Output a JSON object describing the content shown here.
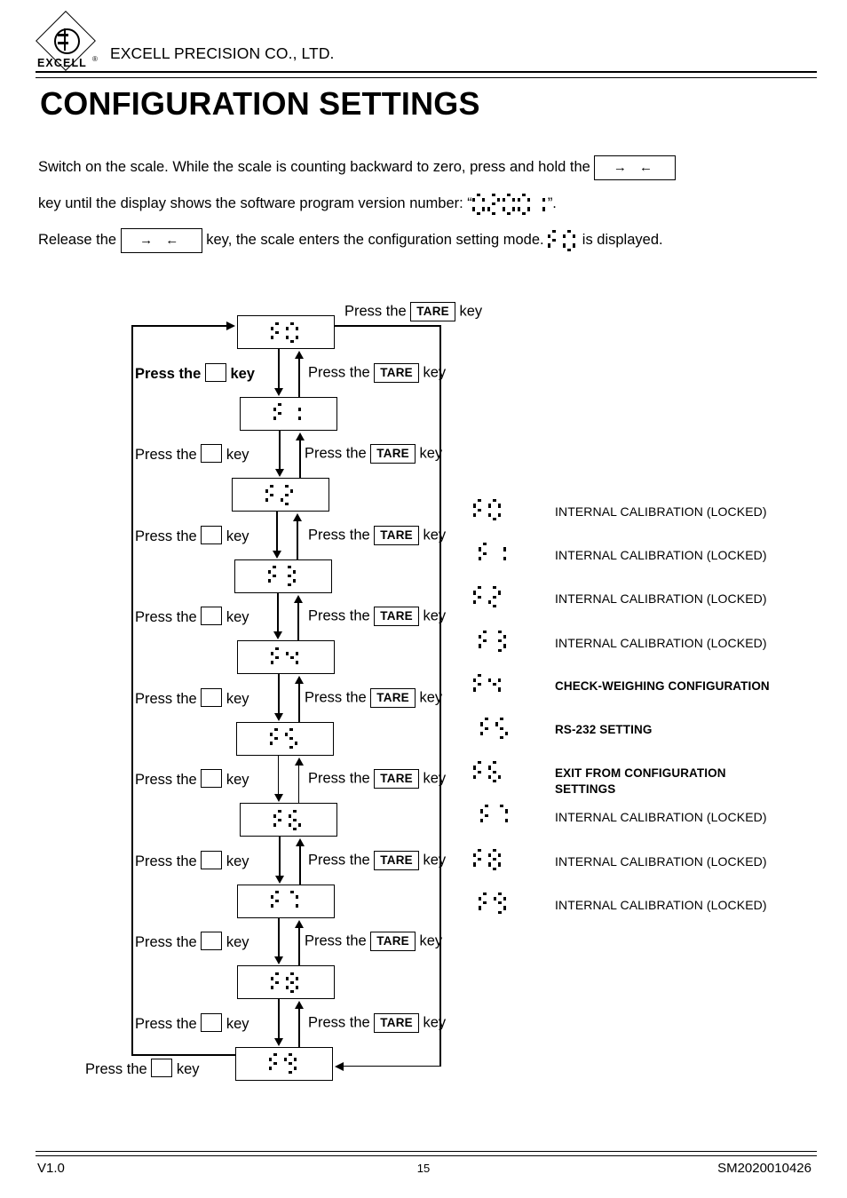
{
  "header": {
    "logo_text": "EXCELL",
    "logo_registered": "®",
    "logo_icon": "excell-diamond-logo",
    "company_name": "EXCELL PRECISION CO., LTD."
  },
  "title": "CONFIGURATION SETTINGS",
  "intro": {
    "line1_a": "Switch on the scale.   While the scale is counting backward to zero, press and hold the",
    "line1_key": "→ ←",
    "line2_a": "key until the display shows the software program version number: “",
    "line2_segments": "02001",
    "line2_b": "”.",
    "line3_a": "Release the",
    "line3_key": "→ ←",
    "line3_b": "key, the scale enters the configuration setting mode.",
    "line3_segments": "F0",
    "line3_c": "is displayed."
  },
  "flow": {
    "top_label_press": "Press the",
    "top_label_key": "key",
    "tare_key": "TARE",
    "blank_key": "",
    "press_the": "Press the",
    "key_word": "key",
    "bottom_label_press": "Press the",
    "bottom_label_key": "key",
    "steps": [
      {
        "code": "F0"
      },
      {
        "code": "F1"
      },
      {
        "code": "F2"
      },
      {
        "code": "F3"
      },
      {
        "code": "F4"
      },
      {
        "code": "F5"
      },
      {
        "code": "F6"
      },
      {
        "code": "F7"
      },
      {
        "code": "F8"
      },
      {
        "code": "F9"
      }
    ],
    "rows": [
      {
        "left_press": "Press the",
        "left_key": "key",
        "right_press": "Press the",
        "right_tare": "TARE",
        "right_key": "key",
        "left_bold": true
      },
      {
        "left_press": "Press the",
        "left_key": "key",
        "right_press": "Press the",
        "right_tare": "TARE",
        "right_key": "key",
        "left_bold": false
      },
      {
        "left_press": "Press the",
        "left_key": "key",
        "right_press": "Press the",
        "right_tare": "TARE",
        "right_key": "key",
        "left_bold": false
      },
      {
        "left_press": "Press the",
        "left_key": "key",
        "right_press": "Press the",
        "right_tare": "TARE",
        "right_key": "key",
        "left_bold": false
      },
      {
        "left_press": "Press the",
        "left_key": "key",
        "right_press": "Press the",
        "right_tare": "TARE",
        "right_key": "key",
        "left_bold": false
      },
      {
        "left_press": "Press the",
        "left_key": "key",
        "right_press": "Press the",
        "right_tare": "TARE",
        "right_key": "key",
        "left_bold": false
      },
      {
        "left_press": "Press the",
        "left_key": "key",
        "right_press": "Press the",
        "right_tare": "TARE",
        "right_key": "key",
        "left_bold": false
      },
      {
        "left_press": "Press the",
        "left_key": "key",
        "right_press": "Press the",
        "right_tare": "TARE",
        "right_key": "key",
        "left_bold": false
      },
      {
        "left_press": "Press the",
        "left_key": "key",
        "right_press": "Press the",
        "right_tare": "TARE",
        "right_key": "key",
        "left_bold": false
      }
    ]
  },
  "legend": [
    {
      "code": "F0",
      "desc": "INTERNAL CALIBRATION (LOCKED)",
      "bold": false
    },
    {
      "code": "F1",
      "desc": "INTERNAL CALIBRATION (LOCKED)",
      "bold": false
    },
    {
      "code": "F2",
      "desc": "INTERNAL CALIBRATION (LOCKED)",
      "bold": false
    },
    {
      "code": "F3",
      "desc": "INTERNAL CALIBRATION (LOCKED)",
      "bold": false
    },
    {
      "code": "F4",
      "desc": "CHECK-WEIGHING CONFIGURATION",
      "bold": true
    },
    {
      "code": "F5",
      "desc": "RS-232 SETTING",
      "bold": true
    },
    {
      "code": "F6",
      "desc": "EXIT FROM CONFIGURATION\n SETTINGS",
      "bold": true
    },
    {
      "code": "F7",
      "desc": "INTERNAL CALIBRATION (LOCKED)",
      "bold": false
    },
    {
      "code": "F8",
      "desc": "INTERNAL CALIBRATION (LOCKED)",
      "bold": false
    },
    {
      "code": "F9",
      "desc": "INTERNAL CALIBRATION (LOCKED)",
      "bold": false
    }
  ],
  "footer": {
    "version": "V1.0",
    "page_number": "15",
    "doc_number": "SM2020010426"
  }
}
